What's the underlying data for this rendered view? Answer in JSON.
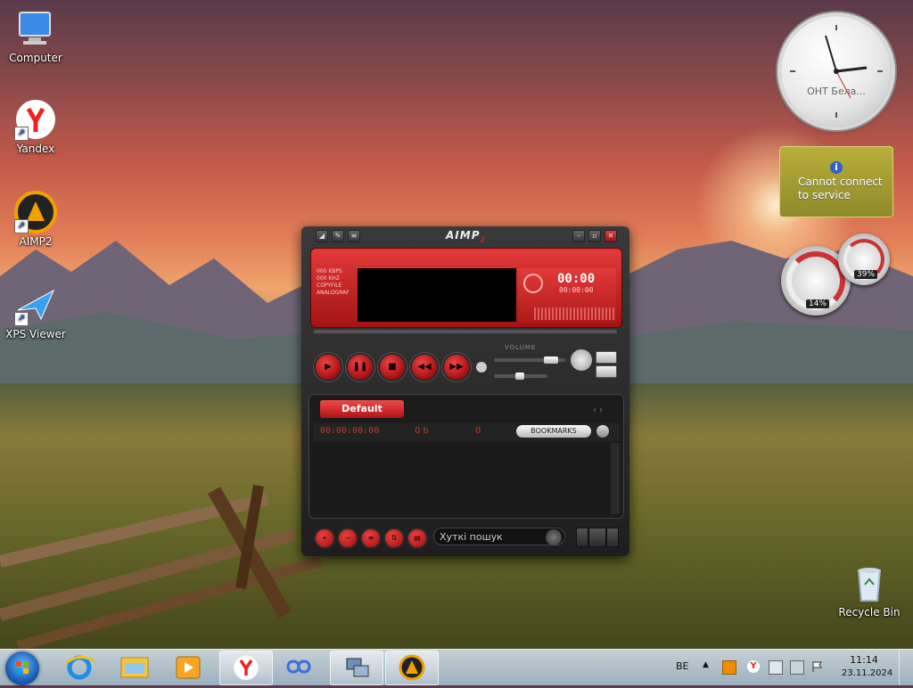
{
  "desktop": {
    "icons": [
      {
        "label": "Computer",
        "icon": "computer-icon"
      },
      {
        "label": "Yandex",
        "icon": "yandex-browser-icon"
      },
      {
        "label": "AIMP2",
        "icon": "aimp-icon"
      },
      {
        "label": "XPS Viewer",
        "icon": "xps-viewer-icon"
      },
      {
        "label": "Recycle Bin",
        "icon": "recycle-bin-icon"
      }
    ]
  },
  "gadgets": {
    "clock_label": "ОНТ Бела...",
    "weather_message_line1": "Cannot connect",
    "weather_message_line2": "to service",
    "cpu_percent": "14%",
    "memory_percent": "39%"
  },
  "aimp": {
    "title": "AIMP",
    "title_sub": "2",
    "display": {
      "left_line1": "000 KBPS",
      "left_line2": "000 KHZ",
      "left_line3": "COPYFILE",
      "left_line4": "ANALOGRAF",
      "time": "00:00",
      "time_total": "00:00:00"
    },
    "volume_label": "VOLUME",
    "playlist": {
      "tab_label": "Default",
      "duration": "00:00:00:00",
      "size": "0 b",
      "count": "0",
      "bookmarks_label": "BOOKMARKS"
    },
    "search_placeholder": "Хуткі пошук"
  },
  "taskbar": {
    "apps": [
      "internet-explorer-icon",
      "windows-explorer-icon",
      "media-player-icon",
      "yandex-browser-icon",
      "infinity-app-icon",
      "network-app-icon",
      "aimp-icon"
    ],
    "language": "BE",
    "time": "11:14",
    "date": "23.11.2024"
  }
}
